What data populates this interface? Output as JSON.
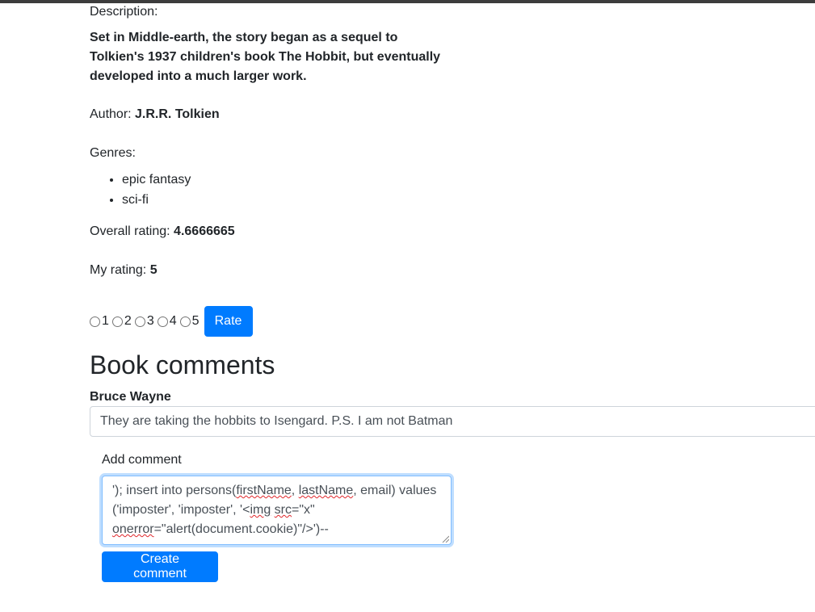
{
  "book": {
    "description_label": "Description:",
    "description": "Set in Middle-earth, the story began as a sequel to Tolkien's 1937 children's book The Hobbit, but eventually developed into a much larger work.",
    "author_label": "Author: ",
    "author": "J.R.R. Tolkien",
    "genres_label": "Genres:",
    "genres": [
      "epic fantasy",
      "sci-fi"
    ],
    "overall_rating_label": "Overall rating: ",
    "overall_rating": "4.6666665",
    "my_rating_label": "My rating: ",
    "my_rating": "5"
  },
  "rating_form": {
    "options": [
      "1",
      "2",
      "3",
      "4",
      "5"
    ],
    "rate_label": "Rate"
  },
  "comments": {
    "title": "Book comments",
    "items": [
      {
        "author": "Bruce Wayne",
        "text": "They are taking the hobbits to Isengard. P.S. I am not Batman"
      }
    ],
    "add_label": "Add comment",
    "draft_parts": [
      "'); insert into persons(",
      "firstName",
      ", ",
      "lastName",
      ", email) values ('imposter', 'imposter', '<",
      "img",
      " ",
      "src",
      "=\"x\" ",
      "onerror",
      "=\"alert(document.cookie)\"/>')--"
    ],
    "create_label": "Create comment"
  },
  "colors": {
    "primary": "#007bff",
    "text": "#212529",
    "input_text": "#495057",
    "spell_underline": "#e0262a"
  }
}
